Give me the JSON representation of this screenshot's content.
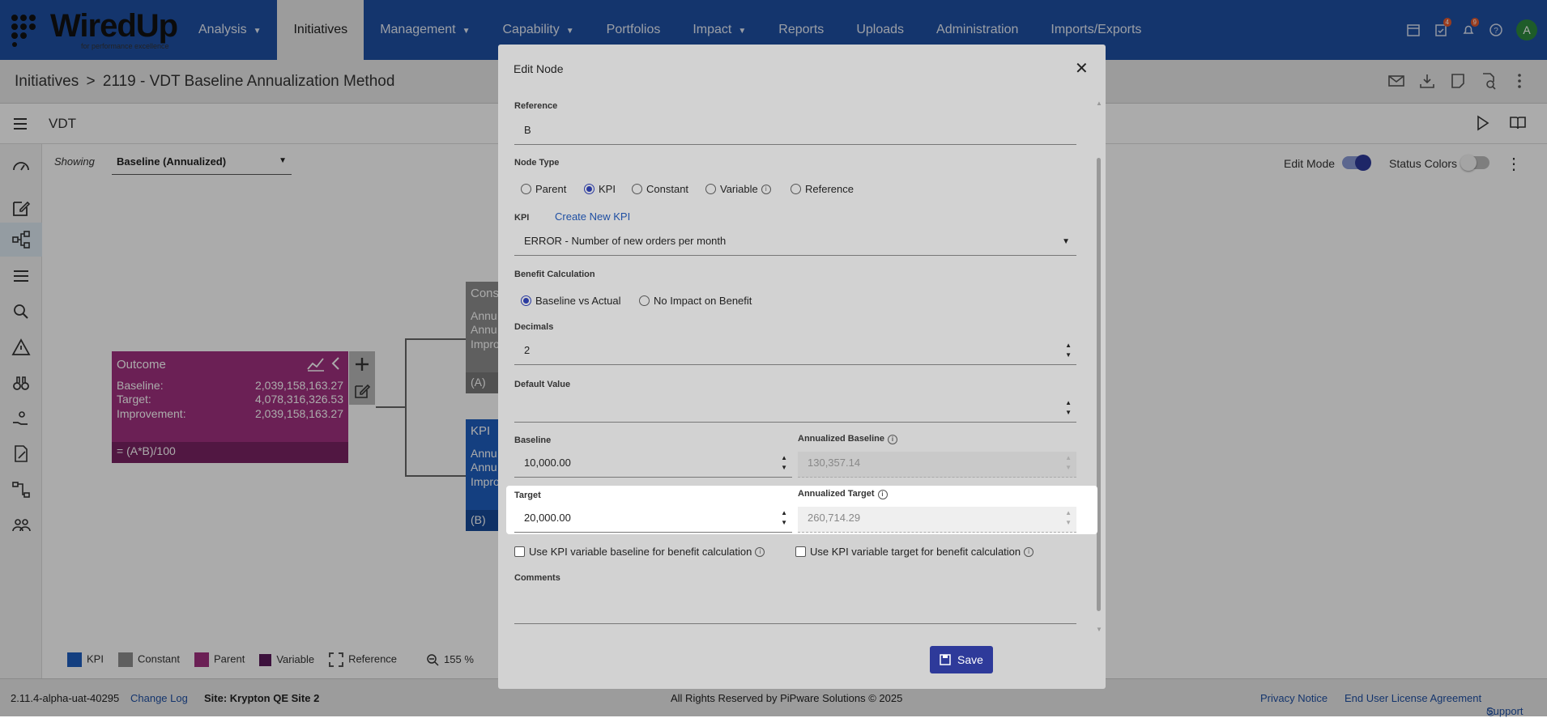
{
  "app": {
    "logo_text": "WiredUp",
    "logo_tagline": "for performance excellence"
  },
  "nav": {
    "items": [
      {
        "label": "Analysis",
        "caret": true
      },
      {
        "label": "Initiatives",
        "caret": false,
        "active": true
      },
      {
        "label": "Management",
        "caret": true
      },
      {
        "label": "Capability",
        "caret": true
      },
      {
        "label": "Portfolios",
        "caret": false
      },
      {
        "label": "Impact",
        "caret": true
      },
      {
        "label": "Reports",
        "caret": false
      },
      {
        "label": "Uploads",
        "caret": false
      },
      {
        "label": "Administration",
        "caret": false
      },
      {
        "label": "Imports/Exports",
        "caret": false
      }
    ],
    "tasks_badge": "4",
    "notifications_badge": "9",
    "avatar": "A"
  },
  "breadcrumb": {
    "root": "Initiatives",
    "separator": ">",
    "current": "2119 - VDT Baseline Annualization Method"
  },
  "vdt": {
    "title": "VDT",
    "showing_label": "Showing",
    "showing_value": "Baseline (Annualized)",
    "edit_mode_label": "Edit Mode",
    "edit_mode_on": true,
    "status_colors_label": "Status Colors",
    "status_colors_on": false
  },
  "tree": {
    "outcome": {
      "title": "Outcome",
      "baseline_label": "Baseline:",
      "baseline_value": "2,039,158,163.27",
      "target_label": "Target:",
      "target_value": "4,078,316,326.53",
      "improvement_label": "Improvement:",
      "improvement_value": "2,039,158,163.27",
      "formula": "= (A*B)/100",
      "color": "#a0307f"
    },
    "const_node": {
      "title": "Cons",
      "line1": "Annu",
      "line2": "Annu",
      "line3": "Impro",
      "ref": "(A)",
      "color": "#8e8e8e"
    },
    "kpi_node": {
      "title": "KPI",
      "line1": "Annu",
      "line2": "Annu",
      "line3": "Impro",
      "ref": "(B)",
      "color": "#1f5fbf"
    }
  },
  "legend": {
    "items": [
      {
        "label": "KPI",
        "color": "#1f5fbf"
      },
      {
        "label": "Constant",
        "color": "#8e8e8e"
      },
      {
        "label": "Parent",
        "color": "#a0307f"
      },
      {
        "label": "Variable",
        "color": "#5a1a5a"
      },
      {
        "label": "Reference",
        "color": "#ffffff"
      }
    ],
    "zoom": "155 %"
  },
  "footer": {
    "version": "2.11.4-alpha-uat-40295",
    "changelog": "Change Log",
    "site": "Site: Krypton QE Site 2",
    "copyright": "All Rights Reserved by PiPware Solutions © 2025",
    "privacy": "Privacy Notice",
    "eula": "End User License Agreement",
    "support": "Support"
  },
  "dialog": {
    "title": "Edit Node",
    "reference_label": "Reference",
    "reference_value": "B",
    "node_type_label": "Node Type",
    "node_types": [
      "Parent",
      "KPI",
      "Constant",
      "Variable",
      "Reference"
    ],
    "node_type_selected": "KPI",
    "kpi_label": "KPI",
    "create_kpi": "Create New KPI",
    "kpi_value": "ERROR - Number of new orders per month",
    "benefit_label": "Benefit Calculation",
    "benefit_options": [
      "Baseline vs Actual",
      "No Impact on Benefit"
    ],
    "benefit_selected": "Baseline vs Actual",
    "decimals_label": "Decimals",
    "decimals_value": "2",
    "default_label": "Default Value",
    "default_value": "",
    "baseline_label": "Baseline",
    "baseline_value": "10,000.00",
    "ann_baseline_label": "Annualized Baseline",
    "ann_baseline_value": "130,357.14",
    "target_label": "Target",
    "target_value": "20,000.00",
    "ann_target_label": "Annualized Target",
    "ann_target_value": "260,714.29",
    "use_kpi_baseline": "Use KPI variable baseline for benefit calculation",
    "use_kpi_target": "Use KPI variable target for benefit calculation",
    "comments_label": "Comments",
    "comments_value": "",
    "save_label": "Save"
  }
}
